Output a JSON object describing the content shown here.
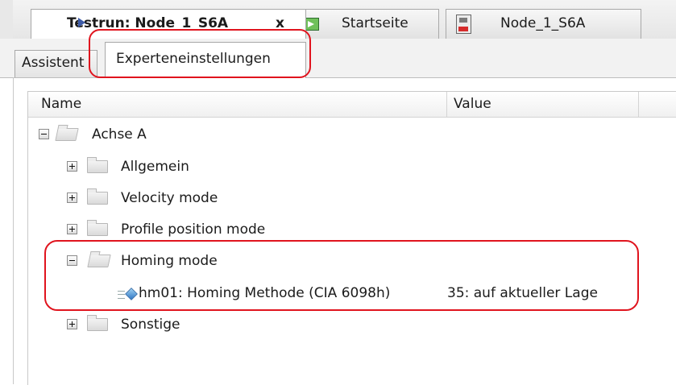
{
  "doc_tabs": [
    {
      "label": "Testrun: Node_1_S6A",
      "close": "x",
      "active": true,
      "icon": "play-arrow-icon"
    },
    {
      "label": "Startseite",
      "active": false,
      "icon": "start-page-icon"
    },
    {
      "label": "Node_1_S6A",
      "active": false,
      "icon": "device-keb-icon"
    }
  ],
  "sub_tabs": [
    {
      "label": "Assistent",
      "active": false
    },
    {
      "label": "Experteneinstellungen",
      "active": true
    }
  ],
  "grid": {
    "columns": [
      "Name",
      "Value"
    ],
    "rows": [
      {
        "label": "Achse A",
        "level": 0,
        "expanded": true,
        "type": "folder"
      },
      {
        "label": "Allgemein",
        "level": 1,
        "expanded": false,
        "type": "folder"
      },
      {
        "label": "Velocity mode",
        "level": 1,
        "expanded": false,
        "type": "folder"
      },
      {
        "label": "Profile position mode",
        "level": 1,
        "expanded": false,
        "type": "folder"
      },
      {
        "label": "Homing mode",
        "level": 1,
        "expanded": true,
        "type": "folder"
      },
      {
        "label": "hm01: Homing Methode (CIA 6098h)",
        "level": 2,
        "type": "parameter",
        "value": "35: auf aktueller Lage"
      },
      {
        "label": "Sonstige",
        "level": 1,
        "expanded": false,
        "type": "folder"
      }
    ]
  },
  "colors": {
    "highlight": "#e0141e",
    "tab_arrow": "#3c5aa6"
  }
}
